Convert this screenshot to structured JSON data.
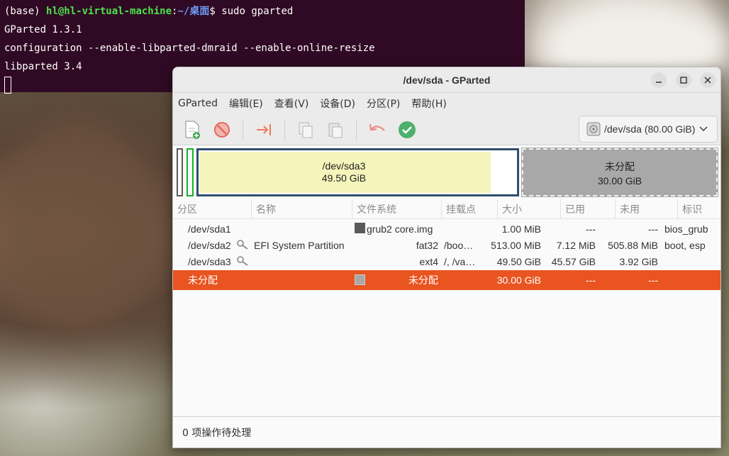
{
  "terminal": {
    "prompt_base": "(base) ",
    "prompt_user": "hl@hl-virtual-machine",
    "prompt_colon": ":",
    "prompt_path": "~/桌面",
    "prompt_dollar": "$ ",
    "command": "sudo gparted",
    "lines": [
      "GParted 1.3.1",
      "configuration --enable-libparted-dmraid --enable-online-resize",
      "libparted 3.4"
    ]
  },
  "window": {
    "title": "/dev/sda - GParted",
    "minimize_icon": "minimize-icon",
    "maximize_icon": "maximize-icon",
    "close_icon": "close-icon"
  },
  "menu": [
    "GParted",
    "编辑(E)",
    "查看(V)",
    "设备(D)",
    "分区(P)",
    "帮助(H)"
  ],
  "toolbar": {
    "icons": [
      "new-partition-icon",
      "delete-icon",
      "resize-move-icon",
      "copy-icon",
      "paste-icon",
      "undo-icon",
      "apply-icon"
    ],
    "device_selector": "/dev/sda (80.00 GiB)"
  },
  "disk_map": {
    "sda3_name": "/dev/sda3",
    "sda3_size": "49.50 GiB",
    "unalloc_name": "未分配",
    "unalloc_size": "30.00 GiB"
  },
  "table": {
    "headers": [
      "分区",
      "名称",
      "文件系统",
      "挂载点",
      "大小",
      "已用",
      "未用",
      "标识"
    ],
    "rows": [
      {
        "partition": "/dev/sda1",
        "name": "",
        "fs_color": "#5a5a5a",
        "filesystem": "grub2 core.img",
        "mount": "",
        "size": "1.00 MiB",
        "used": "---",
        "unused": "---",
        "flags": "bios_grub",
        "key": false
      },
      {
        "partition": "/dev/sda2",
        "name": "EFI System Partition",
        "fs_color": "",
        "filesystem": "fat32",
        "mount": "/boo…",
        "size": "513.00 MiB",
        "used": "7.12 MiB",
        "unused": "505.88 MiB",
        "flags": "boot, esp",
        "key": true
      },
      {
        "partition": "/dev/sda3",
        "name": "",
        "fs_color": "",
        "filesystem": "ext4",
        "mount": "/, /va…",
        "size": "49.50 GiB",
        "used": "45.57 GiB",
        "unused": "3.92 GiB",
        "flags": "",
        "key": true
      },
      {
        "partition": "未分配",
        "name": "",
        "fs_color": "#a8a8a8",
        "filesystem": "未分配",
        "mount": "",
        "size": "30.00 GiB",
        "used": "---",
        "unused": "---",
        "flags": "",
        "key": false
      }
    ]
  },
  "status": "0 项操作待处理",
  "colors": {
    "terminal_bg": "#300a24",
    "selection": "#e95420",
    "ext4": "#314e6c",
    "sda3_fill": "#f5f4bb",
    "unallocated": "#a8a8a8",
    "fat32": "#18b029"
  }
}
